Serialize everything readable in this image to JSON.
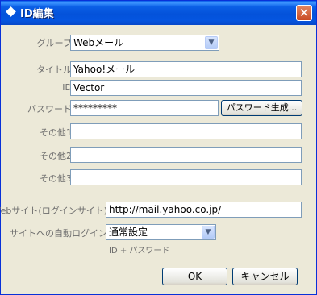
{
  "window": {
    "title": "ID編集",
    "close_glyph": "✕"
  },
  "form": {
    "group": {
      "label": "グループ",
      "value": "Webメール"
    },
    "title": {
      "label": "タイトル",
      "value": "Yahoo!メール"
    },
    "id": {
      "label": "ID",
      "value": "Vector"
    },
    "password": {
      "label": "パスワード",
      "value": "*********",
      "generate_button": "パスワード生成..."
    },
    "other1": {
      "label": "その他1",
      "value": ""
    },
    "other2": {
      "label": "その他2",
      "value": ""
    },
    "other3": {
      "label": "その他3",
      "value": ""
    },
    "website": {
      "label": "Webサイト(ログインサイト)",
      "value": "http://mail.yahoo.co.jp/"
    },
    "auto_login": {
      "label": "サイトへの自動ログイン",
      "value": "通常設定",
      "hint": "ID + パスワード"
    }
  },
  "buttons": {
    "ok": "OK",
    "cancel": "キャンセル"
  },
  "icons": {
    "combo_arrow": "chevron-down-icon"
  }
}
